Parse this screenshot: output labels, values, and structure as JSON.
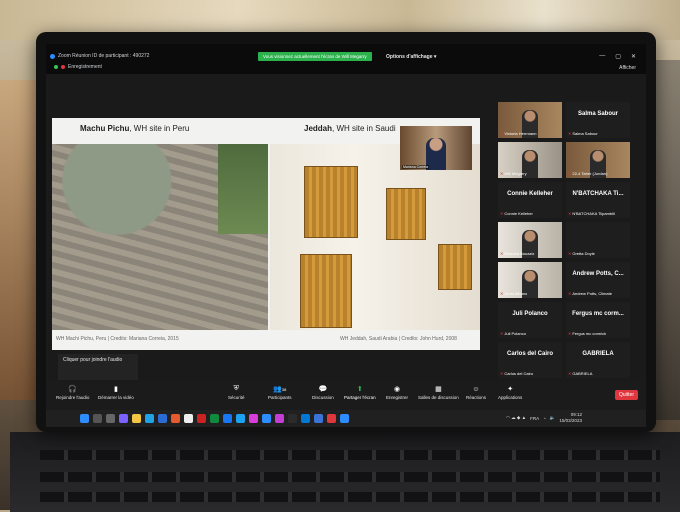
{
  "zoom": {
    "meeting_title": "Zoom Réunion ID de participant : 490272",
    "recording": "Enregistrement",
    "share_banner": "Vous visionnez actuellement l'écran de Will Megarry",
    "view_options": "Options d'affichage",
    "afficher": "Afficher"
  },
  "slide": {
    "left_title_bold": "Machu Pichu",
    "left_title_rest": ", WH site in Peru",
    "right_title_bold": "Jeddah",
    "right_title_rest": ", WH site in Saudi",
    "left_caption": "WH Machi Pichu, Peru | Credits: Mariana Correia, 2015",
    "right_caption": "WH Jeddah, Saudi Arabia | Credits: John Hurd, 2008",
    "inset_name": "Mariana Correia"
  },
  "join_audio": "Cliquer pour joindre l'audio",
  "toolbar": {
    "audio": "Rejoindre l'audio",
    "video": "Démarrer la vidéo",
    "security": "Sécurité",
    "participants": "Participants",
    "participants_count": "38",
    "chat": "Discussion",
    "share": "Partager l'écran",
    "record": "Enregistrer",
    "rooms": "Salles de discussion",
    "reactions": "Réactions",
    "apps": "Applications",
    "quit": "Quitter"
  },
  "taskbar": {
    "lang": "FRA",
    "time": "09:12",
    "date": "15/03/2023"
  },
  "gallery": [
    {
      "name": "Victoria Herrmann",
      "type": "video"
    },
    {
      "name": "Salma Sabour",
      "big": "Salma Sabour",
      "type": "name"
    },
    {
      "name": "Will Megarry",
      "type": "video2"
    },
    {
      "name": "22-4 Taher (Jordan)",
      "type": "video"
    },
    {
      "name": "Connie Kelleher",
      "big": "Connie Kelleher",
      "type": "name"
    },
    {
      "name": "N'BATCHAKA Tiipambili",
      "big": "N'BATCHAKA Ti...",
      "type": "name"
    },
    {
      "name": "Khaoula Bouaziz",
      "type": "video3"
    },
    {
      "name": "Gretta Doyle",
      "type": "blank"
    },
    {
      "name": "Jenni Albano",
      "type": "video3"
    },
    {
      "name": "Andrew Potts, Climate",
      "big": "Andrew Potts, C...",
      "type": "name"
    },
    {
      "name": "Juli Polanco",
      "big": "Juli Polanco",
      "type": "name"
    },
    {
      "name": "Fergus mc cormick",
      "big": "Fergus mc corm...",
      "type": "name"
    },
    {
      "name": "Carlos del Cairo",
      "big": "Carlos del Cairo",
      "type": "name"
    },
    {
      "name": "GABRIELA",
      "big": "GABRIELA",
      "type": "name"
    }
  ]
}
